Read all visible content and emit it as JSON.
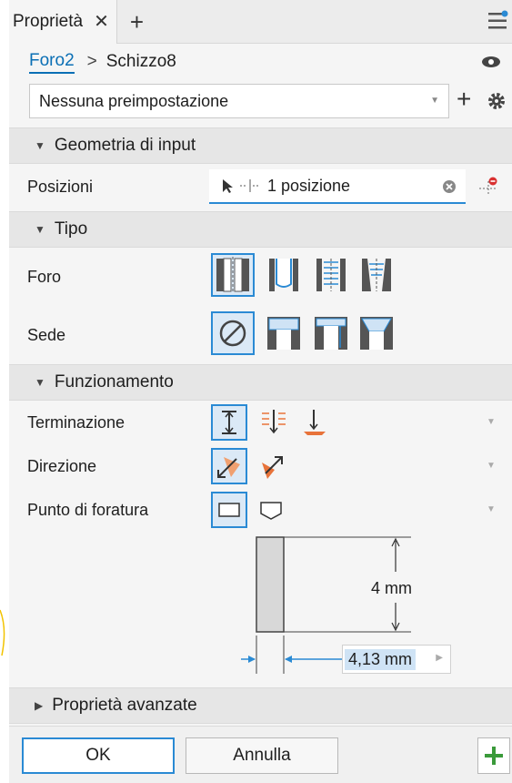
{
  "tab": {
    "title": "Proprietà",
    "close": "✕",
    "add": "+"
  },
  "breadcrumb": {
    "feature": "Foro2",
    "separator": ">",
    "sketch": "Schizzo8"
  },
  "preset": {
    "value": "Nessuna preimpostazione",
    "add": "+"
  },
  "sections": {
    "input_geometry": "Geometria di input",
    "type": "Tipo",
    "behavior": "Funzionamento",
    "advanced": "Proprietà avanzate"
  },
  "fields": {
    "positions_label": "Posizioni",
    "positions_value": "1 posizione",
    "hole_label": "Foro",
    "seat_label": "Sede",
    "termination_label": "Terminazione",
    "direction_label": "Direzione",
    "drill_point_label": "Punto di foratura"
  },
  "preview": {
    "depth": "4 mm",
    "diameter": "4,13 mm"
  },
  "footer": {
    "ok": "OK",
    "cancel": "Annulla",
    "add": "+"
  },
  "colors": {
    "accent": "#2a8ad4",
    "link": "#0a6fb5",
    "orange": "#e8733a",
    "green": "#3a9a3a",
    "red": "#d93030",
    "bgSection": "#e6e6e6"
  },
  "icons": [
    "close-icon",
    "plus-icon",
    "hamburger-icon",
    "eye-icon",
    "gear-icon",
    "cursor-icon",
    "crosshair-icon",
    "clear-icon",
    "remove-point-icon",
    "simple-hole-icon",
    "clearance-hole-icon",
    "tapped-hole-icon",
    "taper-tapped-hole-icon",
    "no-seat-icon",
    "counterbore-icon",
    "spotface-icon",
    "countersink-icon",
    "distance-icon",
    "through-all-icon",
    "to-icon",
    "direction-default-icon",
    "direction-flip-icon",
    "flat-point-icon",
    "angle-point-icon",
    "add-icon"
  ]
}
